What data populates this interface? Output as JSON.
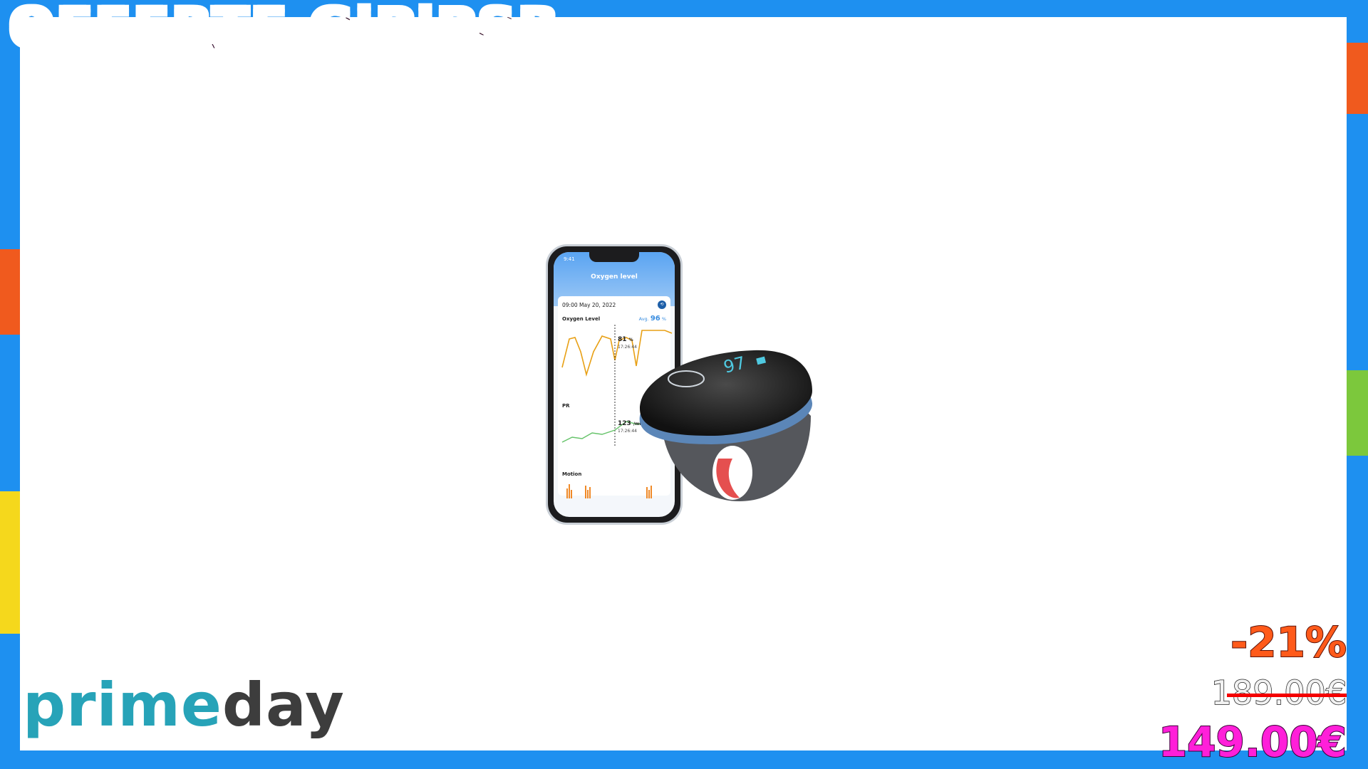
{
  "banner": {
    "title": "OFFERTE GiPiPSB"
  },
  "logo": {
    "prime": "prime",
    "day": "day"
  },
  "pricing": {
    "discount": "-21%",
    "old_price": "189.00€",
    "new_price": "149.00€"
  },
  "product_phone_screen": {
    "time": "9:41",
    "title": "Oxygen level",
    "date": "09:00 May 20, 2022",
    "oxygen_label": "Oxygen Level",
    "avg_label": "Avg.",
    "avg_value": "96",
    "avg_unit": "%",
    "spo2_readout": "81",
    "spo2_unit": "%",
    "timestamp": "17:26:44",
    "pr_label": "PR",
    "pr_readout": "123",
    "pr_unit": "/min",
    "motion_label": "Motion"
  },
  "product_ring": {
    "display_value": "97"
  },
  "colors": {
    "background": "#1e90f0",
    "discount": "#ff5a1a",
    "new_price": "#ff1fd9",
    "strike": "#f40000",
    "prime": "#27a3b8"
  }
}
